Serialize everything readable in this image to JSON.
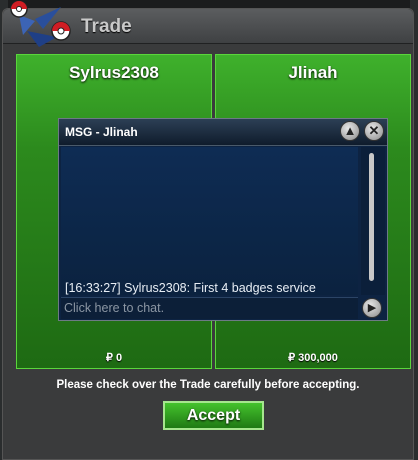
{
  "window": {
    "title": "Trade"
  },
  "trade": {
    "left": {
      "name": "Sylrus2308",
      "money": "₽ 0"
    },
    "right": {
      "name": "Jlinah",
      "money": "₽ 300,000"
    }
  },
  "chat": {
    "title": "MSG - Jlinah",
    "messages": [
      "[16:33:27] Sylrus2308: First 4 badges service"
    ],
    "placeholder": "Click here to chat."
  },
  "footer": {
    "instruction": "Please check over the Trade carefully before accepting.",
    "accept_label": "Accept"
  },
  "colors": {
    "panel_green": "#2c8a1d",
    "chat_blue": "#0d2342",
    "window_gray": "#3a3b3c"
  },
  "icons": [
    "pokeball-logo-icon",
    "chevron-up-icon",
    "close-icon",
    "send-arrow-icon"
  ]
}
